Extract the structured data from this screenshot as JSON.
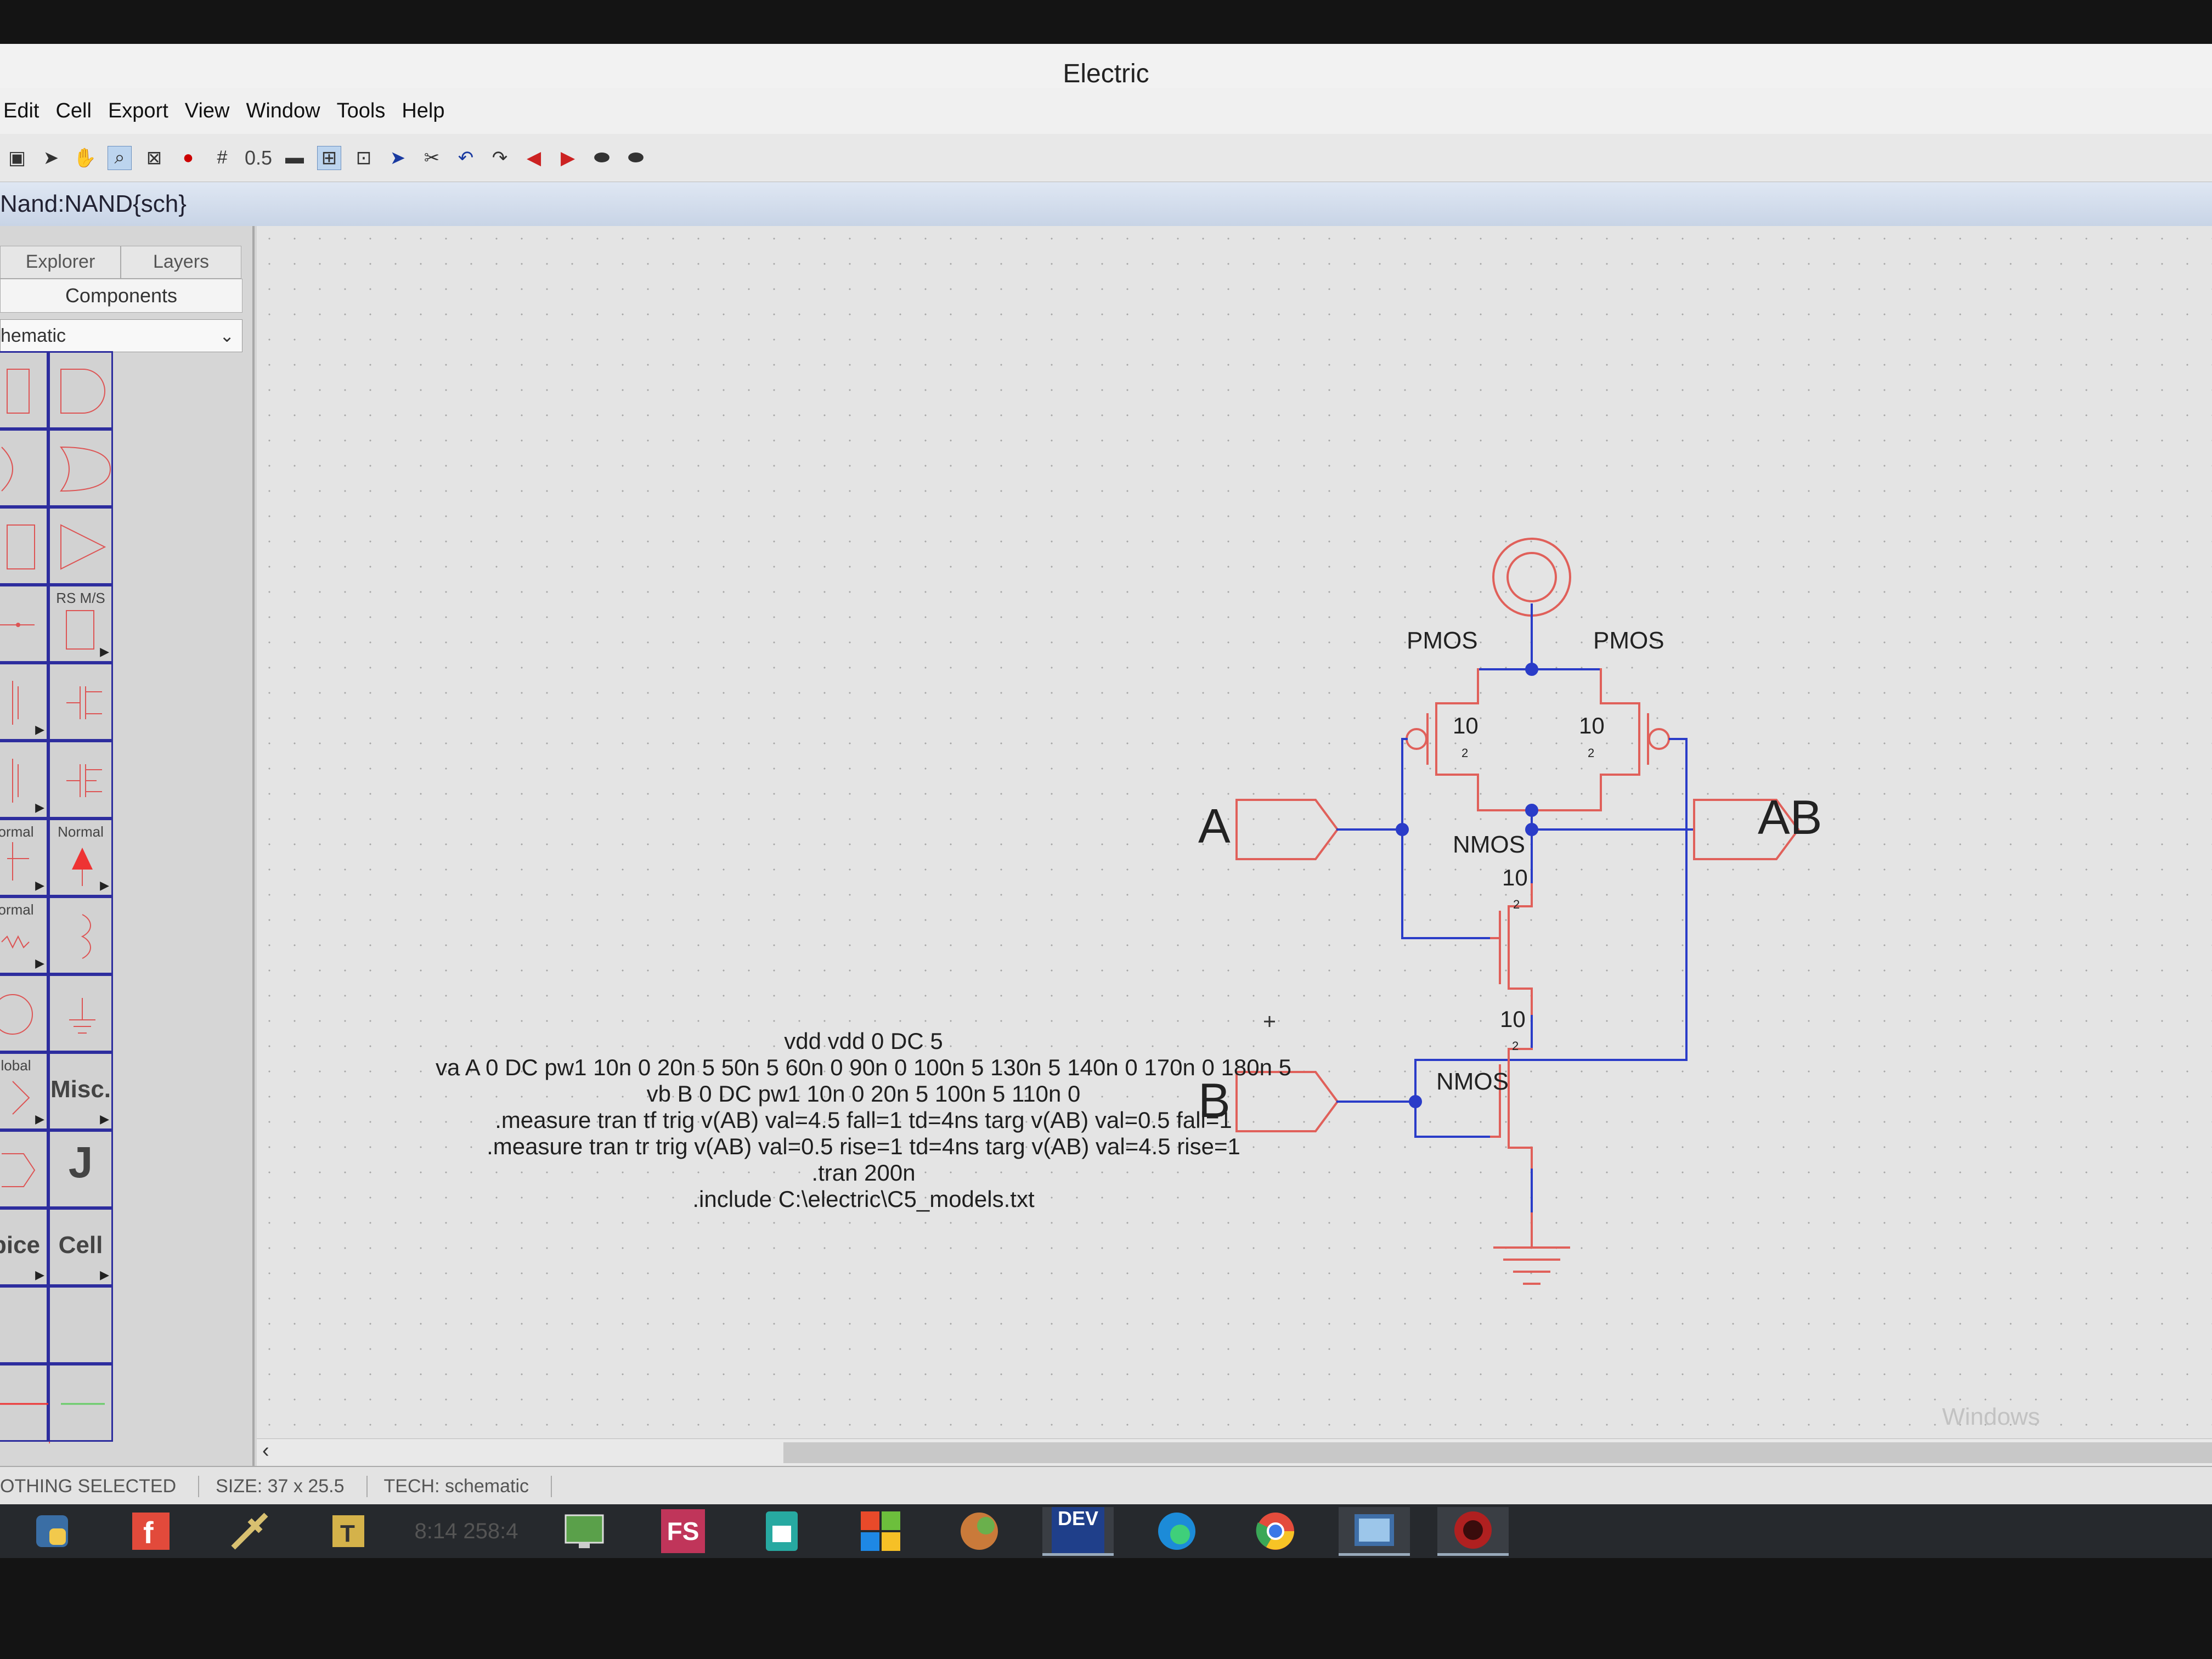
{
  "window": {
    "title": "Electric"
  },
  "menu": [
    "Edit",
    "Cell",
    "Export",
    "View",
    "Window",
    "Tools",
    "Help"
  ],
  "toolbar": {
    "grid_value": "0.5"
  },
  "cell_title": "Nand:NAND{sch}",
  "sidebar": {
    "tabs": [
      "Explorer",
      "Layers"
    ],
    "components_tab": "Components",
    "technology": "hematic",
    "palette_labels": {
      "rsms": "RS M/S",
      "normal_1": "ormal",
      "normal_2": "Normal",
      "normal_3": "ormal",
      "global": "lobal",
      "misc": "Misc.",
      "j": "J",
      "spice": "pice",
      "cell": "Cell"
    }
  },
  "schematic": {
    "labels": {
      "pmos_left": "PMOS",
      "pmos_right": "PMOS",
      "nmos_top": "NMOS",
      "nmos_bottom": "NMOS"
    },
    "sizes": {
      "pmos_left": "10",
      "pmos_right": "10",
      "nmos_top": "10",
      "nmos_bottom": "10"
    },
    "sublabels": {
      "pmos_left": "2",
      "pmos_right": "2",
      "nmos_top": "2",
      "nmos_bottom": "2"
    },
    "ports": {
      "a": "A",
      "b": "B",
      "out": "AB"
    },
    "spice_lines": [
      "vdd vdd 0 DC 5",
      "va A 0 DC pw1 10n 0 20n 5 50n 5 60n 0 90n 0 100n 5 130n 5 140n 0 170n 0 180n 5",
      "vb B 0 DC pw1 10n 0 20n 5 100n 5 110n 0",
      ".measure tran tf trig v(AB) val=4.5 fall=1 td=4ns targ v(AB) val=0.5 fall=1",
      ".measure tran tr trig v(AB) val=0.5 rise=1 td=4ns targ v(AB) val=4.5 rise=1",
      ".tran 200n",
      ".include C:\\electric\\C5_models.txt"
    ]
  },
  "status": {
    "selection": "OTHING SELECTED",
    "size": "SIZE: 37 x 25.5",
    "tech": "TECH: schematic"
  },
  "taskbar": {
    "clock_ghost": "8:14 258:4",
    "fs": "FS",
    "dev": "DEV"
  },
  "watermark": "Windows"
}
